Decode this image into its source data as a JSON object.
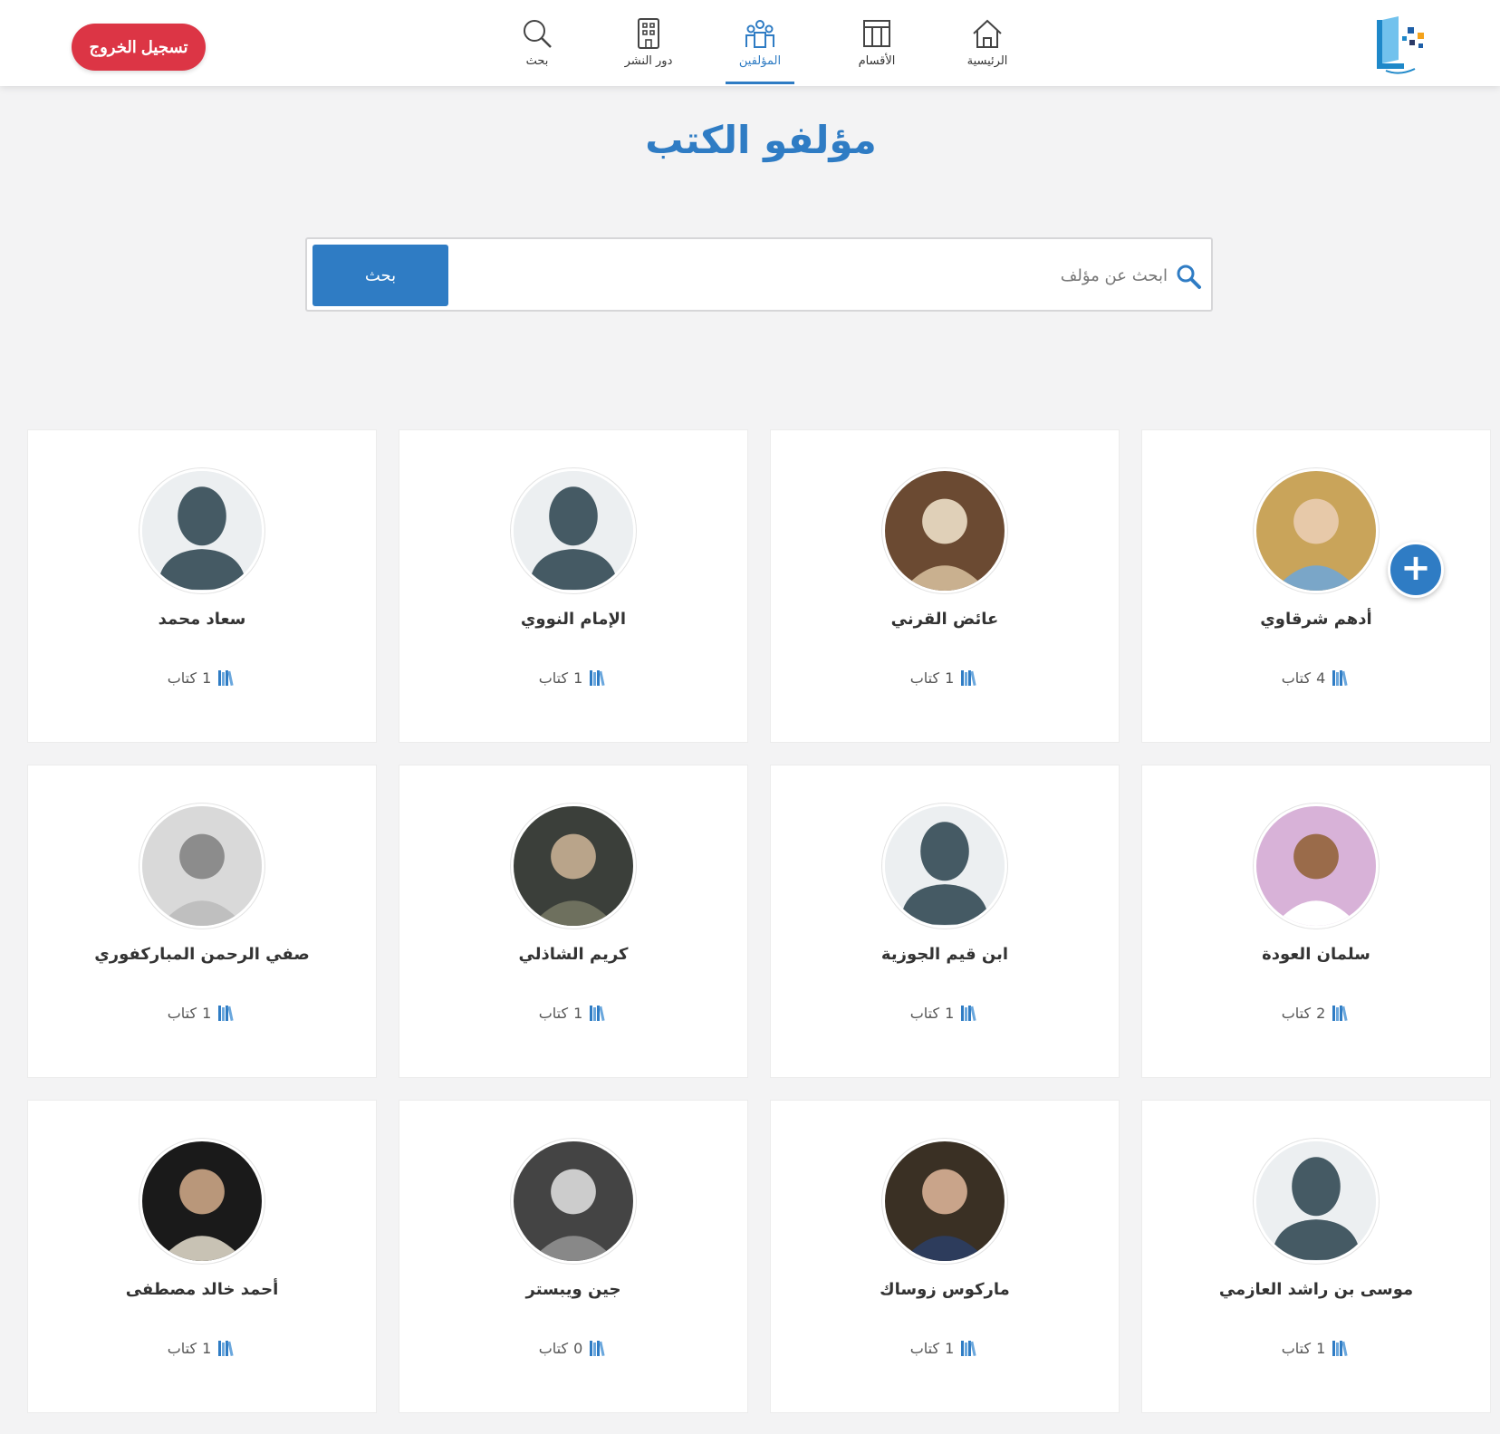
{
  "header": {
    "logout_label": "تسجيل الخروج",
    "nav": [
      {
        "key": "home",
        "label": "الرئيسية",
        "icon": "home-icon"
      },
      {
        "key": "sections",
        "label": "الأقسام",
        "icon": "sections-icon"
      },
      {
        "key": "authors",
        "label": "المؤلفين",
        "icon": "authors-icon",
        "active": true
      },
      {
        "key": "publishers",
        "label": "دور النشر",
        "icon": "building-icon"
      },
      {
        "key": "search",
        "label": "بحث",
        "icon": "search-icon"
      }
    ]
  },
  "page": {
    "title": "مؤلفو الكتب"
  },
  "search": {
    "placeholder": "ابحث عن مؤلف",
    "button_label": "بحث"
  },
  "colors": {
    "accent": "#2f7cc4",
    "danger": "#dc3545",
    "background": "#f3f3f4"
  },
  "book_unit": "كتاب",
  "authors": [
    {
      "name": "أدهم شرقاوي",
      "count": "4",
      "avatar": "photo"
    },
    {
      "name": "عائض القرني",
      "count": "1",
      "avatar": "photo"
    },
    {
      "name": "الإمام النووي",
      "count": "1",
      "avatar": "placeholder"
    },
    {
      "name": "سعاد محمد",
      "count": "1",
      "avatar": "placeholder"
    },
    {
      "name": "سلمان العودة",
      "count": "2",
      "avatar": "photo"
    },
    {
      "name": "ابن قيم الجوزية",
      "count": "1",
      "avatar": "placeholder"
    },
    {
      "name": "كريم الشاذلي",
      "count": "1",
      "avatar": "photo"
    },
    {
      "name": "صفي الرحمن المباركفوري",
      "count": "1",
      "avatar": "photo"
    },
    {
      "name": "موسى بن راشد العازمي",
      "count": "1",
      "avatar": "placeholder"
    },
    {
      "name": "ماركوس زوساك",
      "count": "1",
      "avatar": "photo"
    },
    {
      "name": "جين ويبستر",
      "count": "0",
      "avatar": "photo"
    },
    {
      "name": "أحمد خالد مصطفى",
      "count": "1",
      "avatar": "photo"
    }
  ]
}
